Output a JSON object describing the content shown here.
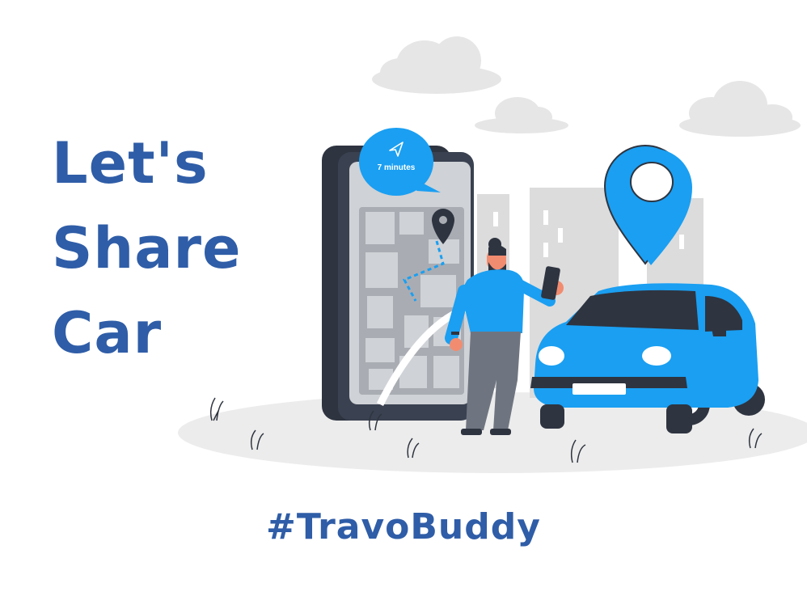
{
  "headline": {
    "line1": "Let's",
    "line2": "Share",
    "line3": "Car"
  },
  "phone_bubble": {
    "eta_text": "7 minutes",
    "icon": "navigation-arrow-icon"
  },
  "hashtag": "#TravoBuddy",
  "colors": {
    "brand_text": "#2f5da7",
    "accent_blue": "#1a9ff2",
    "dark": "#2e3440",
    "ground": "#ececec"
  },
  "icons": [
    "map-pin-icon",
    "navigation-arrow-icon",
    "location-marker-icon",
    "cloud-icon",
    "car-icon",
    "person-icon",
    "phone-icon"
  ]
}
